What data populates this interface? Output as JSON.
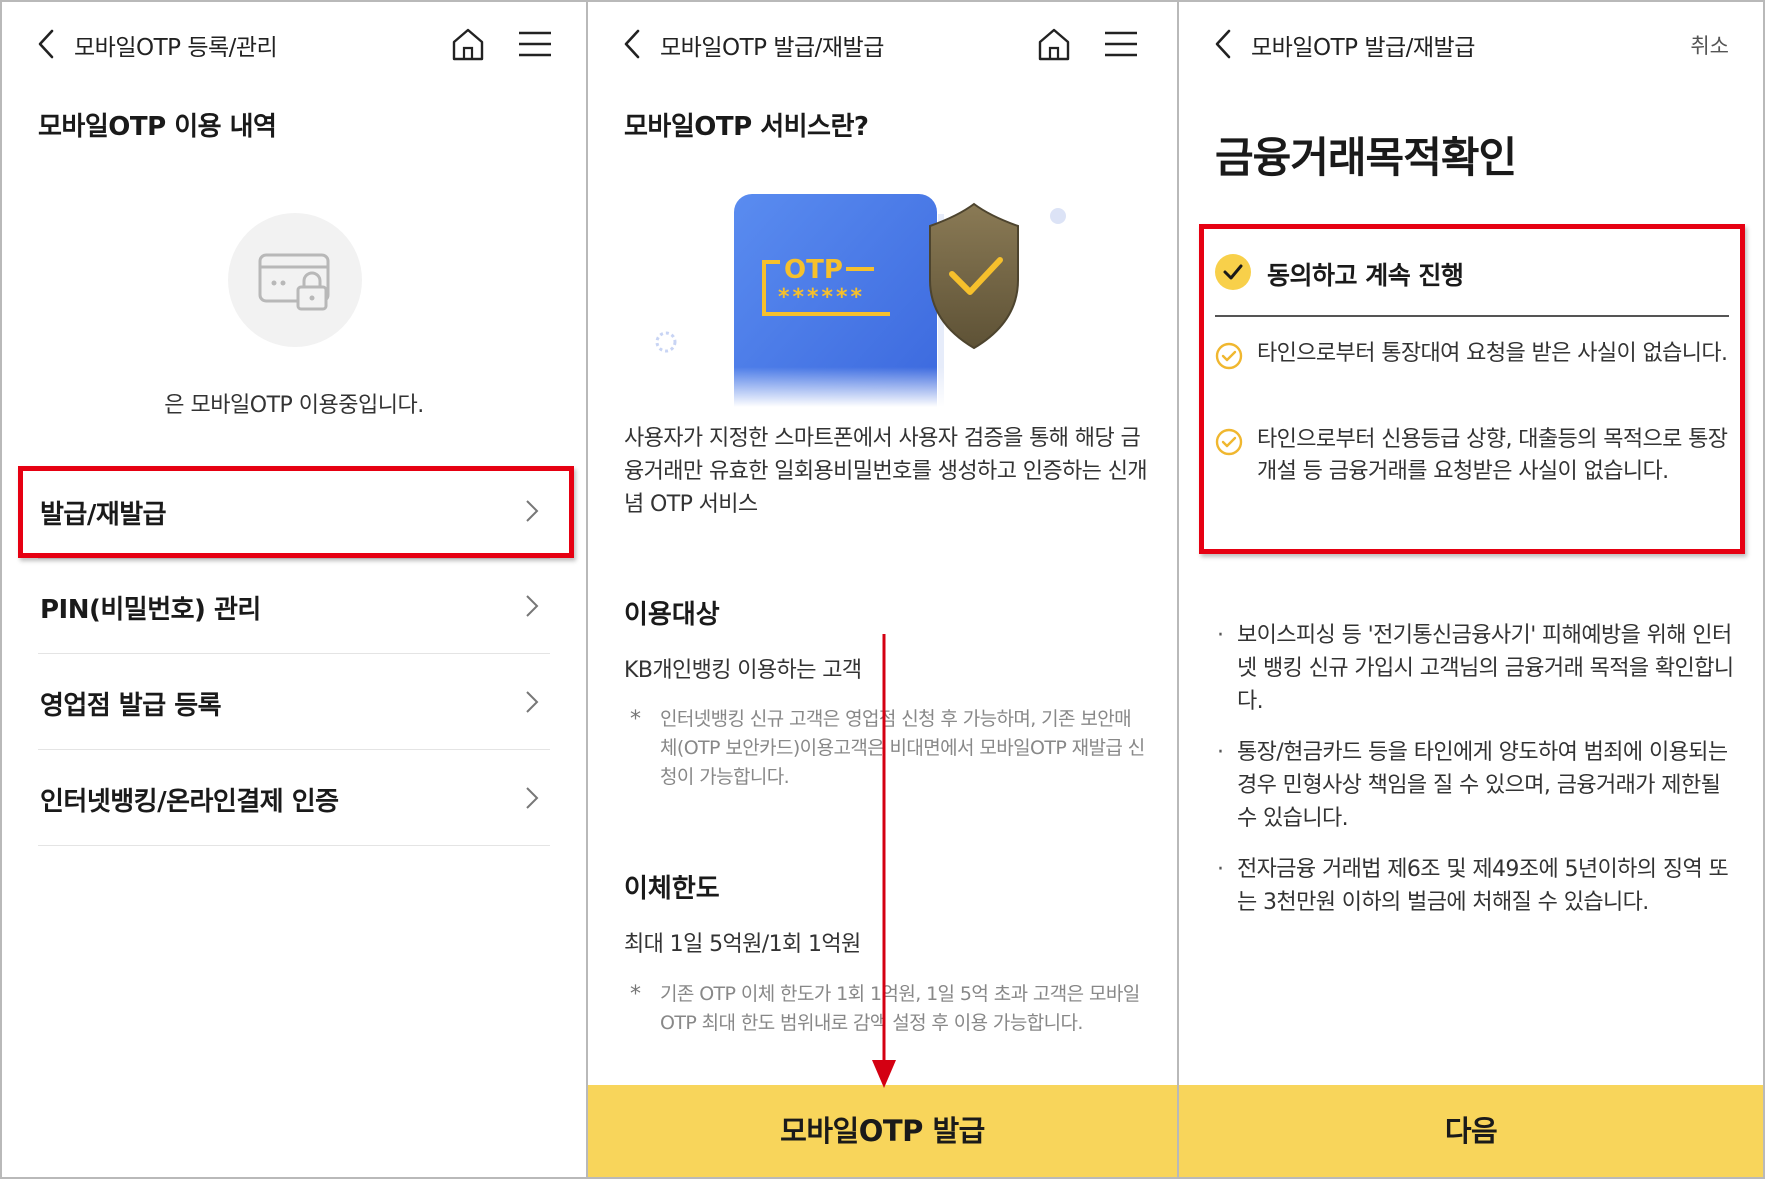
{
  "panel1": {
    "header_title": "모바일OTP 등록/관리",
    "section_title": "모바일OTP 이용 내역",
    "status_text": "은 모바일OTP 이용중입니다.",
    "menu": [
      {
        "label": "발급/재발급"
      },
      {
        "label": "PIN(비밀번호) 관리"
      },
      {
        "label": "영업점 발급 등록"
      },
      {
        "label": "인터넷뱅킹/온라인결제 인증"
      }
    ]
  },
  "panel2": {
    "header_title": "모바일OTP 발급/재발급",
    "section_title": "모바일OTP 서비스란?",
    "illustration": {
      "otp_label": "OTP",
      "otp_code": "******"
    },
    "intro": "사용자가 지정한 스마트폰에서 사용자 검증을 통해 해당 금융거래만 유효한 일회용비밀번호를 생성하고 인증하는 신개념 OTP 서비스",
    "target_title": "이용대상",
    "target_text": "KB개인뱅킹 이용하는 고객",
    "target_note": "인터넷뱅킹 신규 고객은 영업점 신청 후 가능하며, 기존 보안매체(OTP 보안카드)이용고객은 비대면에서 모바일OTP 재발급 신청이 가능합니다.",
    "limit_title": "이체한도",
    "limit_text": "최대 1일 5억원/1회 1억원",
    "limit_note": "기존 OTP 이체 한도가 1회 1억원, 1일 5억 초과 고객은 모바일OTP 최대 한도 범위내로 감액 설정 후 이용 가능합니다.",
    "note_marker": "*",
    "issue_button": "모바일OTP 발급"
  },
  "panel3": {
    "header_title": "모바일OTP 발급/재발급",
    "cancel": "취소",
    "title": "금융거래목적확인",
    "agree_all": "동의하고 계속 진행",
    "agree_items": [
      "타인으로부터 통장대여 요청을 받은 사실이 없습니다.",
      "타인으로부터 신용등급 상향, 대출등의 목적으로 통장개설 등 금융거래를 요청받은 사실이 없습니다."
    ],
    "bullet_marker": "·",
    "notices": [
      "보이스피싱 등 '전기통신금융사기' 피해예방을 위해 인터넷 뱅킹 신규 가입시 고객님의 금융거래 목적을 확인합니다.",
      "통장/현금카드 등을 타인에게 양도하여 범죄에 이용되는 경우 민형사상 책임을 질 수 있으며, 금융거래가 제한될 수 있습니다.",
      "전자금융 거래법 제6조 및 제49조에 5년이하의 징역 또는 3천만원 이하의 벌금에 처해질 수 있습니다."
    ],
    "next_button": "다음"
  },
  "colors": {
    "accent_yellow": "#f8d55b",
    "highlight_red": "#e60012",
    "annotation_arrow": "#d40012"
  },
  "icons": [
    "back-chevron-icon",
    "home-icon",
    "hamburger-menu-icon",
    "card-lock-icon",
    "chevron-right-icon",
    "check-circle-icon",
    "otp-shield-illustration"
  ]
}
